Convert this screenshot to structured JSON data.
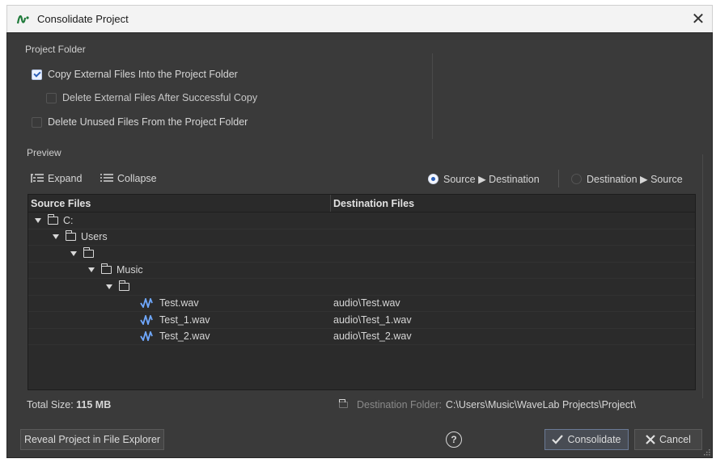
{
  "window": {
    "title": "Consolidate Project",
    "close_glyph": "✕"
  },
  "project_folder": {
    "label": "Project Folder",
    "options": [
      {
        "label": "Copy External Files Into the Project Folder",
        "checked": true
      },
      {
        "label": "Delete External Files After Successful Copy",
        "checked": false
      },
      {
        "label": "Delete Unused Files From the Project Folder",
        "checked": false
      }
    ]
  },
  "preview": {
    "label": "Preview",
    "expand_label": "Expand",
    "collapse_label": "Collapse",
    "direction_options": [
      {
        "label": "Source ▶ Destination",
        "selected": true
      },
      {
        "label": "Destination ▶ Source",
        "selected": false
      }
    ]
  },
  "table": {
    "columns": [
      "Source Files",
      "Destination Files"
    ],
    "rows": [
      {
        "type": "folder",
        "level": 0,
        "name": "C:",
        "destination": ""
      },
      {
        "type": "folder",
        "level": 1,
        "name": "Users",
        "destination": ""
      },
      {
        "type": "folder",
        "level": 2,
        "name": "",
        "destination": ""
      },
      {
        "type": "folder",
        "level": 3,
        "name": "Music",
        "destination": ""
      },
      {
        "type": "folder",
        "level": 4,
        "name": "",
        "destination": ""
      },
      {
        "type": "audio",
        "level": 5,
        "name": "Test.wav",
        "destination": "audio\\Test.wav"
      },
      {
        "type": "audio",
        "level": 5,
        "name": "Test_1.wav",
        "destination": "audio\\Test_1.wav"
      },
      {
        "type": "audio",
        "level": 5,
        "name": "Test_2.wav",
        "destination": "audio\\Test_2.wav"
      }
    ]
  },
  "footer": {
    "total_size_label": "Total Size:",
    "total_size_value": "115 MB",
    "destination_label": "Destination Folder:",
    "destination_value": "C:\\Users\\Music\\WaveLab Projects\\Project\\"
  },
  "buttons": {
    "reveal": "Reveal Project in File Explorer",
    "help": "?",
    "consolidate": "Consolidate",
    "cancel": "Cancel"
  },
  "colors": {
    "accent": "#2b5fb8",
    "background": "#3a3a3a",
    "table_bg": "#2b2b2b",
    "wave_icon": "#6fa8ff"
  }
}
